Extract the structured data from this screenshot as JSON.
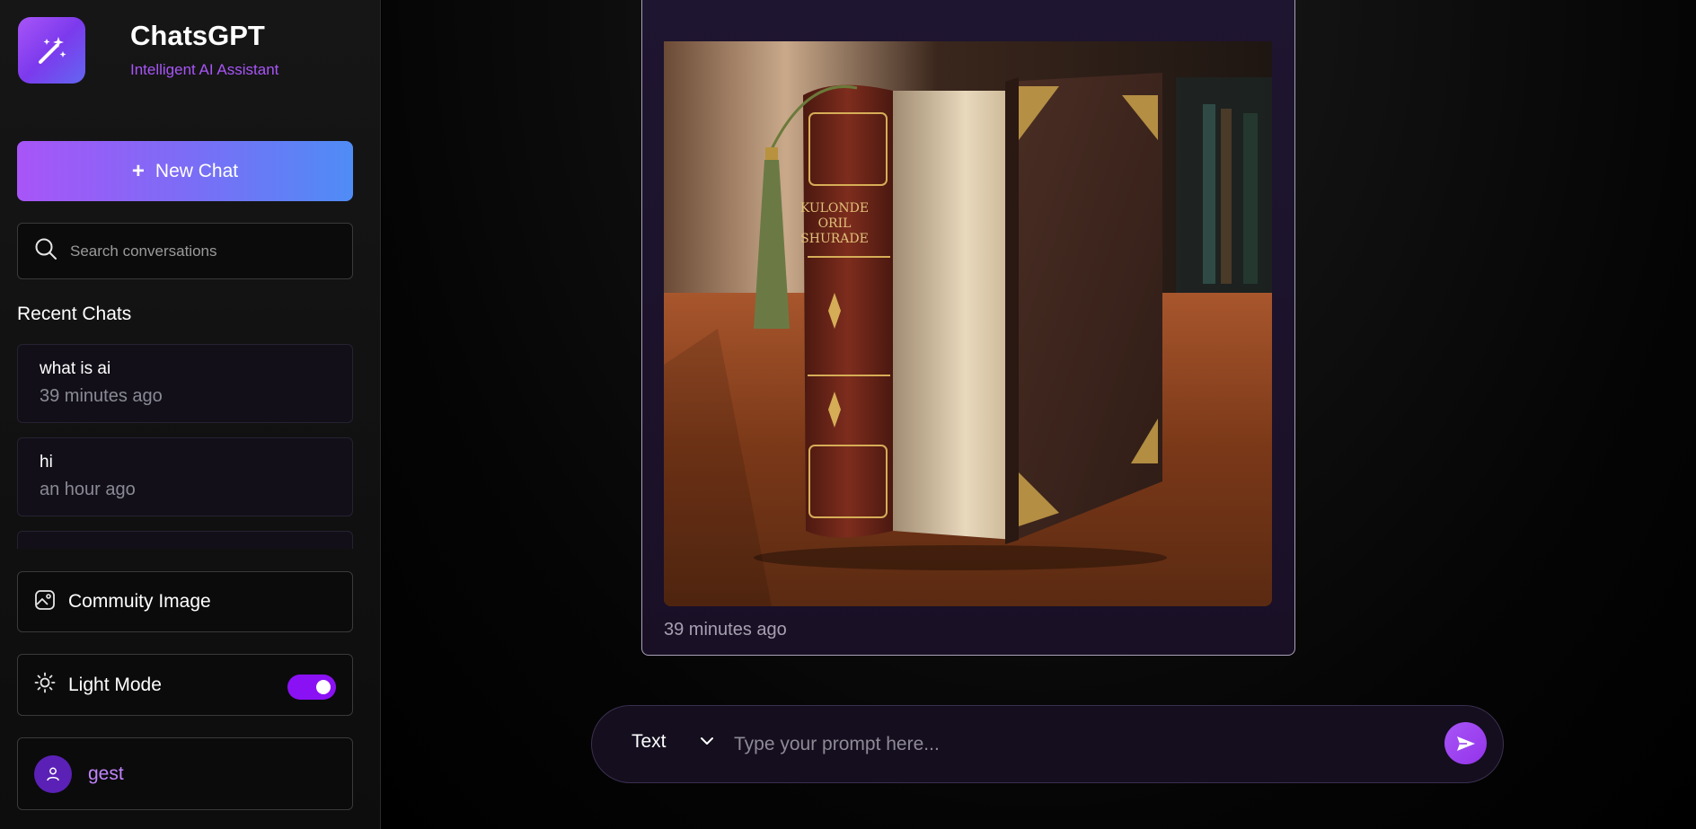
{
  "brand": {
    "title": "ChatsGPT",
    "subtitle": "Intelligent AI Assistant",
    "icon": "magic-wand-icon"
  },
  "sidebar": {
    "new_chat_label": "New Chat",
    "search": {
      "placeholder": "Search conversations"
    },
    "recent_title": "Recent Chats",
    "recent_chats": [
      {
        "title": "what is ai",
        "time": "39 minutes ago"
      },
      {
        "title": "hi",
        "time": "an hour ago"
      },
      {
        "title": "",
        "time": ""
      }
    ],
    "community_label": "Commuity Image",
    "light_mode_label": "Light Mode",
    "light_mode_on": true,
    "user_name": "gest"
  },
  "message": {
    "image_title_text": "KULONDE ORIL SHURADE",
    "time": "39 minutes ago"
  },
  "composer": {
    "mode": "Text",
    "placeholder": "Type your prompt here..."
  },
  "colors": {
    "accent": "#a855f7",
    "toggle": "#8b11f5",
    "user_name": "#c084fc"
  }
}
